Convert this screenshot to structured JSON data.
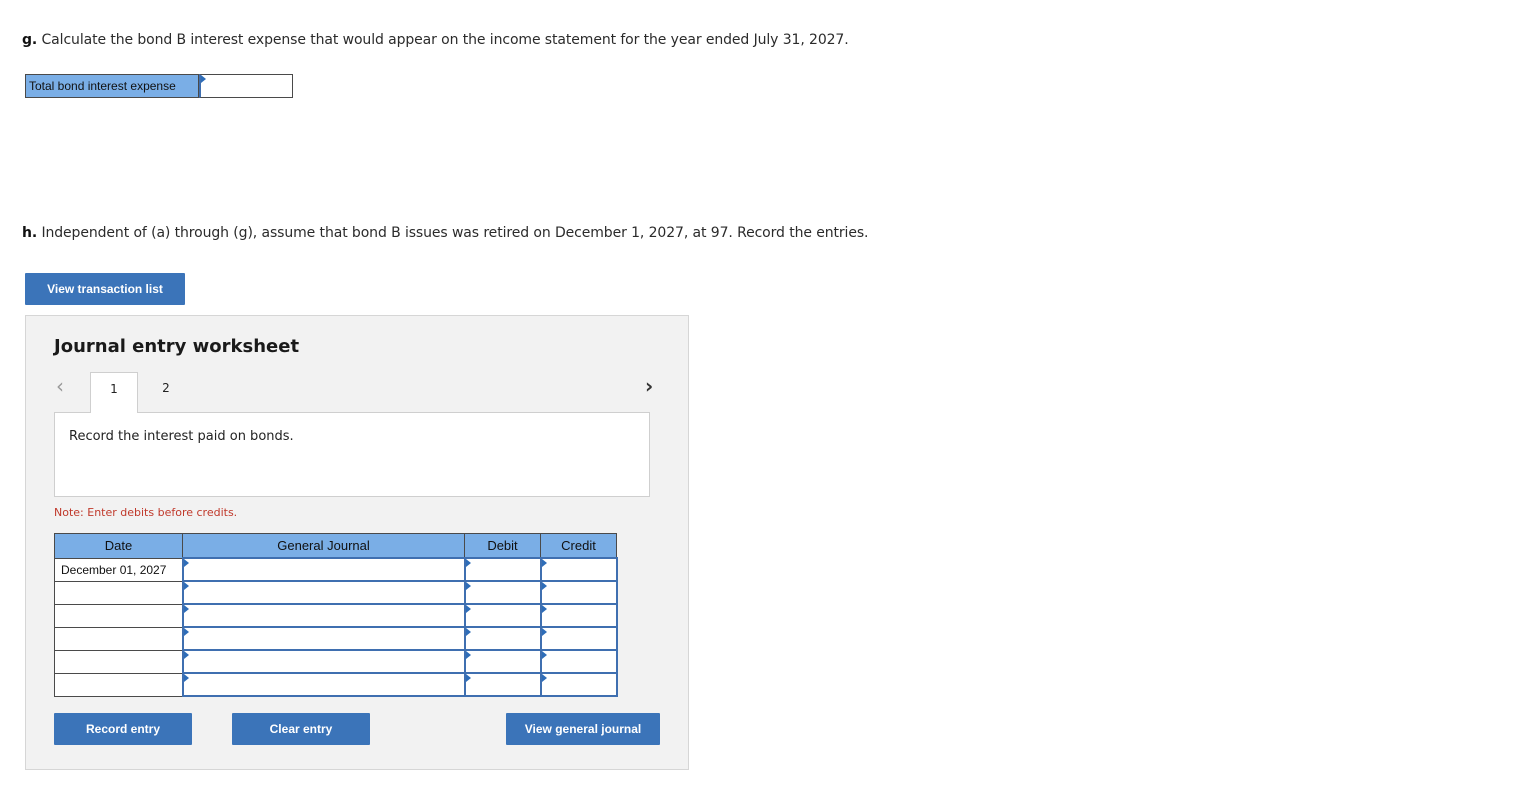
{
  "question_g": {
    "letter": "g.",
    "text": "Calculate the bond B interest expense that would appear on the income statement for the year ended July 31, 2027.",
    "answer_label": "Total bond interest expense",
    "answer_value": ""
  },
  "question_h": {
    "letter": "h.",
    "text": "Independent of (a) through (g), assume that bond B issues was retired on December 1, 2027, at 97. Record the entries."
  },
  "view_transaction_button": "View transaction list",
  "worksheet": {
    "title": "Journal entry worksheet",
    "tabs": [
      {
        "label": "1",
        "active": true
      },
      {
        "label": "2",
        "active": false
      }
    ],
    "description": "Record the interest paid on bonds.",
    "note": "Note: Enter debits before credits.",
    "columns": {
      "date": "Date",
      "account": "General Journal",
      "debit": "Debit",
      "credit": "Credit"
    },
    "rows": [
      {
        "date": "December 01, 2027",
        "account": "",
        "debit": "",
        "credit": ""
      },
      {
        "date": "",
        "account": "",
        "debit": "",
        "credit": ""
      },
      {
        "date": "",
        "account": "",
        "debit": "",
        "credit": ""
      },
      {
        "date": "",
        "account": "",
        "debit": "",
        "credit": ""
      },
      {
        "date": "",
        "account": "",
        "debit": "",
        "credit": ""
      },
      {
        "date": "",
        "account": "",
        "debit": "",
        "credit": ""
      }
    ],
    "buttons": {
      "record": "Record entry",
      "clear": "Clear entry",
      "view_journal": "View general journal"
    },
    "icons": {
      "prev": "chevron-left-icon",
      "next": "chevron-right-icon"
    }
  },
  "colors": {
    "header_blue": "#7aaee6",
    "button_blue": "#3b74b9",
    "note_red": "#c0392b"
  }
}
